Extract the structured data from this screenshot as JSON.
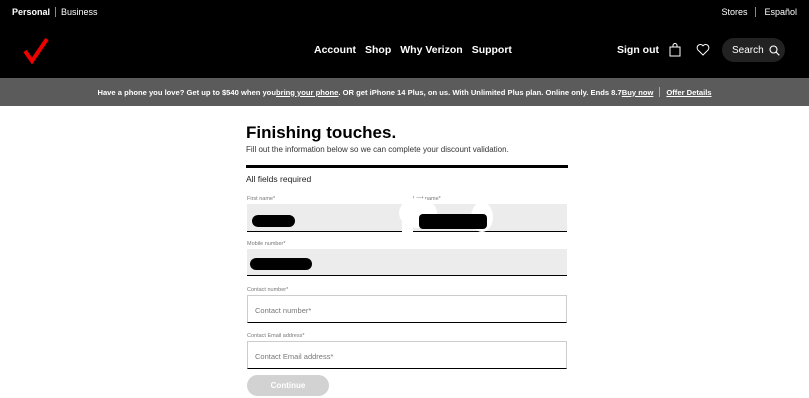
{
  "utility": {
    "personal": "Personal",
    "business": "Business",
    "stores": "Stores",
    "espanol": "Español"
  },
  "nav": {
    "items": [
      "Account",
      "Shop",
      "Why Verizon",
      "Support"
    ],
    "sign_out": "Sign out",
    "search_label": "Search"
  },
  "promo": {
    "text1": "Have a phone you love? Get up to $540 when you ",
    "link1": "bring your phone",
    "text2": ". OR get iPhone 14 Plus, on us. With Unlimited Plus plan. Online only. Ends 8.7 ",
    "link2": "Buy now",
    "link3": "Offer Details"
  },
  "form": {
    "title": "Finishing touches.",
    "subtitle": "Fill out the information below so we can complete your discount validation.",
    "required_note": "All fields required",
    "first_name_label": "First name*",
    "last_name_label": "Last name*",
    "mobile_label": "Mobile number*",
    "contact_number_label": "Contact number*",
    "contact_number_placeholder": "Contact number*",
    "contact_email_label": "Contact Email address*",
    "contact_email_placeholder": "Contact Email address*",
    "continue_label": "Continue"
  },
  "colors": {
    "brand_red": "#ee0000",
    "nav_bg": "#000000",
    "promo_bg": "#5b5b5b",
    "disabled_button": "#d2d2d2"
  }
}
